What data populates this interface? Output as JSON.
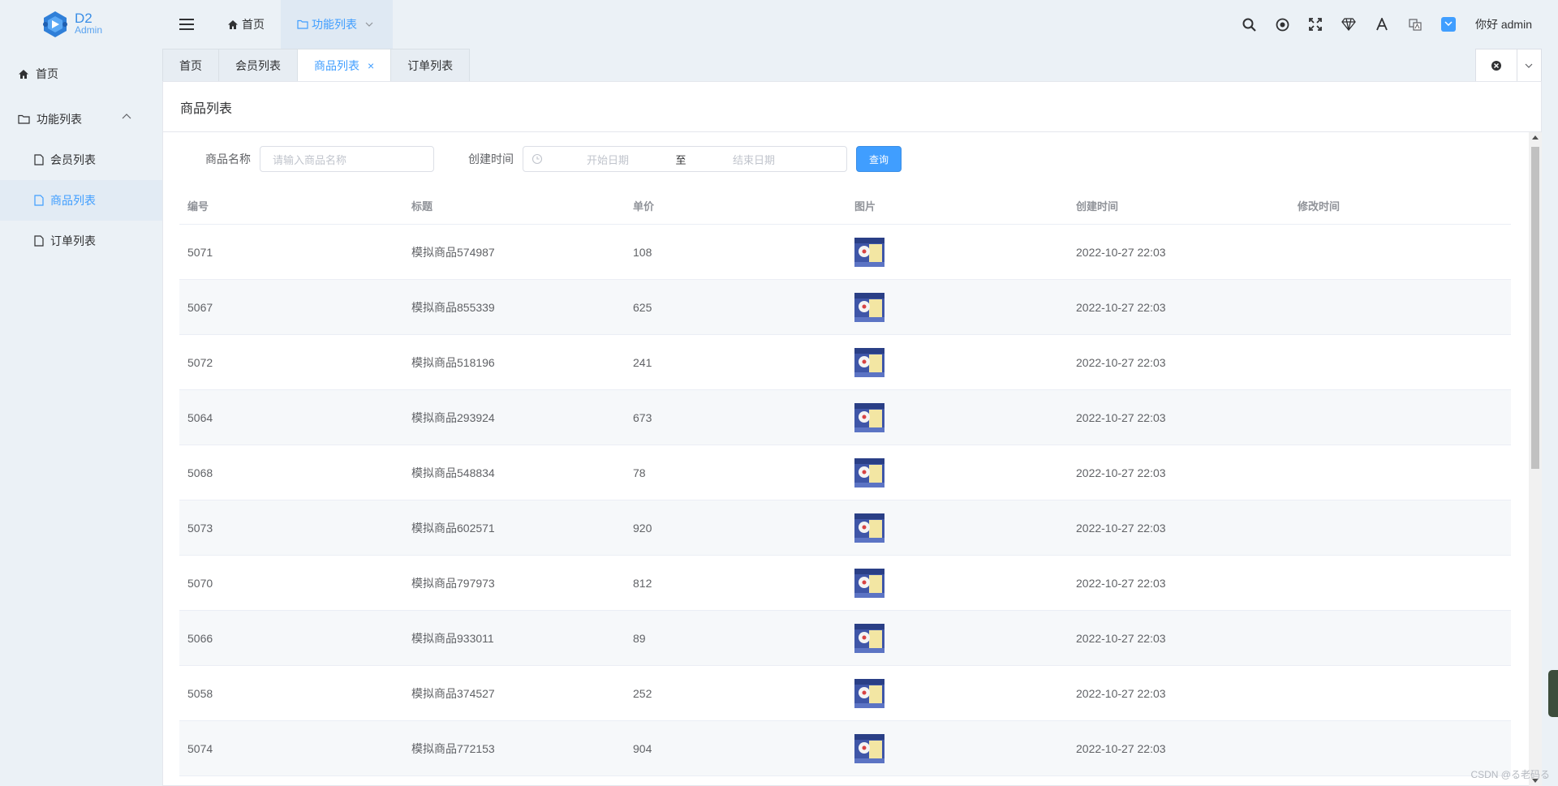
{
  "header": {
    "logo_title": "D2",
    "logo_subtitle": "Admin",
    "menu": [
      {
        "label": "首页"
      },
      {
        "label": "功能列表"
      }
    ],
    "user": "你好 admin",
    "icons": [
      "search-icon",
      "target-icon",
      "fullscreen-icon",
      "theme-icon",
      "font-size-icon",
      "translate-icon",
      "color-picker-icon"
    ]
  },
  "sidebar": {
    "items": [
      {
        "label": "首页"
      },
      {
        "label": "功能列表"
      },
      {
        "label": "会员列表"
      },
      {
        "label": "商品列表"
      },
      {
        "label": "订单列表"
      }
    ]
  },
  "tabs": [
    {
      "label": "首页"
    },
    {
      "label": "会员列表"
    },
    {
      "label": "商品列表"
    },
    {
      "label": "订单列表"
    }
  ],
  "page": {
    "title": "商品列表",
    "filters": {
      "name_label": "商品名称",
      "name_placeholder": "请输入商品名称",
      "time_label": "创建时间",
      "start_placeholder": "开始日期",
      "range_separator": "至",
      "end_placeholder": "结束日期",
      "query_button": "查询"
    }
  },
  "table": {
    "columns": [
      "编号",
      "标题",
      "单价",
      "图片",
      "创建时间",
      "修改时间"
    ],
    "rows": [
      {
        "id": "5071",
        "title": "模拟商品574987",
        "price": "108",
        "created": "2022-10-27 22:03",
        "modified": ""
      },
      {
        "id": "5067",
        "title": "模拟商品855339",
        "price": "625",
        "created": "2022-10-27 22:03",
        "modified": ""
      },
      {
        "id": "5072",
        "title": "模拟商品518196",
        "price": "241",
        "created": "2022-10-27 22:03",
        "modified": ""
      },
      {
        "id": "5064",
        "title": "模拟商品293924",
        "price": "673",
        "created": "2022-10-27 22:03",
        "modified": ""
      },
      {
        "id": "5068",
        "title": "模拟商品548834",
        "price": "78",
        "created": "2022-10-27 22:03",
        "modified": ""
      },
      {
        "id": "5073",
        "title": "模拟商品602571",
        "price": "920",
        "created": "2022-10-27 22:03",
        "modified": ""
      },
      {
        "id": "5070",
        "title": "模拟商品797973",
        "price": "812",
        "created": "2022-10-27 22:03",
        "modified": ""
      },
      {
        "id": "5066",
        "title": "模拟商品933011",
        "price": "89",
        "created": "2022-10-27 22:03",
        "modified": ""
      },
      {
        "id": "5058",
        "title": "模拟商品374527",
        "price": "252",
        "created": "2022-10-27 22:03",
        "modified": ""
      },
      {
        "id": "5074",
        "title": "模拟商品772153",
        "price": "904",
        "created": "2022-10-27 22:03",
        "modified": ""
      }
    ]
  },
  "watermark": "CSDN @る老码る",
  "colors": {
    "accent": "#409eff",
    "background": "#ebf1f6"
  }
}
